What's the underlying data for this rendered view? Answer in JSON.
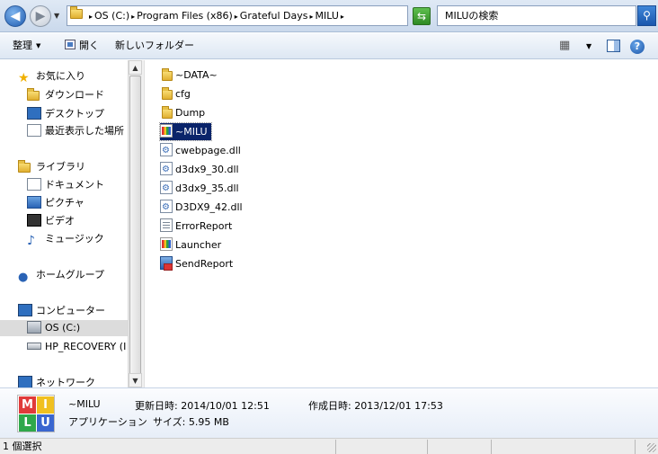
{
  "address": {
    "crumbs": [
      "OS (C:)",
      "Program Files (x86)",
      "Grateful Days",
      "MILU"
    ],
    "separator": "▸",
    "search_placeholder": "MILUの検索"
  },
  "toolbar": {
    "organize": "整理",
    "open": "開く",
    "new_folder": "新しいフォルダー"
  },
  "nav": {
    "favorites": "お気に入り",
    "downloads": "ダウンロード",
    "desktop": "デスクトップ",
    "recent": "最近表示した場所",
    "libraries": "ライブラリ",
    "documents": "ドキュメント",
    "pictures": "ピクチャ",
    "videos": "ビデオ",
    "music": "ミュージック",
    "homegroup": "ホームグループ",
    "computer": "コンピューター",
    "drive_c": "OS (C:)",
    "recovery": "HP_RECOVERY (I",
    "network": "ネットワーク"
  },
  "files": [
    {
      "name": "~DATA~",
      "type": "folder"
    },
    {
      "name": "cfg",
      "type": "folder"
    },
    {
      "name": "Dump",
      "type": "folder"
    },
    {
      "name": "~MILU",
      "type": "milu"
    },
    {
      "name": "cwebpage.dll",
      "type": "dll"
    },
    {
      "name": "d3dx9_30.dll",
      "type": "dll"
    },
    {
      "name": "d3dx9_35.dll",
      "type": "dll"
    },
    {
      "name": "D3DX9_42.dll",
      "type": "dll"
    },
    {
      "name": "ErrorReport",
      "type": "text"
    },
    {
      "name": "Launcher",
      "type": "milu"
    },
    {
      "name": "SendReport",
      "type": "send"
    }
  ],
  "selected_file": "~MILU",
  "details": {
    "name": "~MILU",
    "type": "アプリケーション",
    "modified_label": "更新日時:",
    "modified": "2014/10/01 12:51",
    "size_label": "サイズ:",
    "size": "5.95 MB",
    "created_label": "作成日時:",
    "created": "2013/12/01 17:53",
    "icon_letters": [
      "M",
      "I",
      "L",
      "U"
    ],
    "icon_colors": [
      "#e03a3a",
      "#f0c020",
      "#2fa84a",
      "#3a66d0"
    ]
  },
  "status": {
    "text": "1 個選択"
  }
}
